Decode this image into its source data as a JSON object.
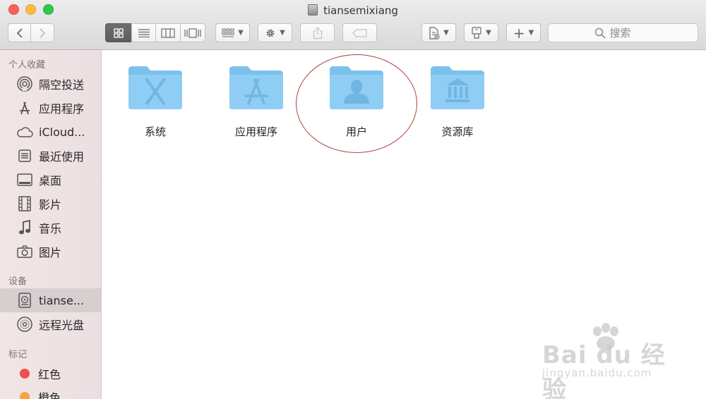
{
  "window": {
    "title": "tiansemixiang"
  },
  "toolbar": {
    "back": "‹",
    "forward": "›",
    "view_modes": [
      "icon-view",
      "list-view",
      "column-view",
      "cover-flow-view"
    ],
    "arrange": "arrange",
    "action": "action",
    "share": "share",
    "tags": "tags",
    "new_file": "new-file",
    "path": "path",
    "add": "+",
    "search_placeholder": "搜索"
  },
  "sidebar": {
    "favorites_header": "个人收藏",
    "favorites": [
      {
        "label": "隔空投送",
        "icon": "airdrop-icon"
      },
      {
        "label": "应用程序",
        "icon": "applications-icon"
      },
      {
        "label": "iCloud...",
        "icon": "icloud-icon"
      },
      {
        "label": "最近使用",
        "icon": "recents-icon"
      },
      {
        "label": "桌面",
        "icon": "desktop-icon"
      },
      {
        "label": "影片",
        "icon": "movies-icon"
      },
      {
        "label": "音乐",
        "icon": "music-icon"
      },
      {
        "label": "图片",
        "icon": "pictures-icon"
      }
    ],
    "devices_header": "设备",
    "devices": [
      {
        "label": "tianse...",
        "icon": "hard-disk-icon",
        "selected": true
      },
      {
        "label": "远程光盘",
        "icon": "remote-disc-icon"
      }
    ],
    "tags_header": "标记",
    "tags": [
      {
        "label": "红色",
        "color": "#f0504b"
      },
      {
        "label": "橙色",
        "color": "#f7a33a"
      }
    ]
  },
  "content": {
    "folders": [
      {
        "label": "系统",
        "icon": "system-folder-icon"
      },
      {
        "label": "应用程序",
        "icon": "applications-folder-icon"
      },
      {
        "label": "用户",
        "icon": "users-folder-icon",
        "highlighted": true
      },
      {
        "label": "资源库",
        "icon": "library-folder-icon"
      }
    ]
  },
  "watermark": {
    "main": "Bai du 经验",
    "sub": "jingyan.baidu.com"
  },
  "colors": {
    "folder_blue": "#8fcdf4",
    "folder_tab": "#7cc1ee",
    "highlight": "#b63b3b",
    "sidebar_selected": "#d6cecf"
  }
}
